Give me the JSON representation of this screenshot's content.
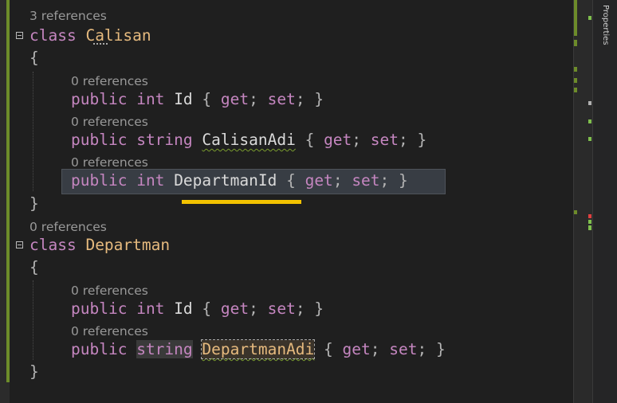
{
  "editor": {
    "blocks": [
      {
        "refs": "3 references",
        "keyword": "class",
        "name": "Calisan",
        "open": "{",
        "close": "}",
        "members": [
          {
            "refs": "0 references",
            "mod": "public",
            "type": "int",
            "name": "Id",
            "acc_open": "{",
            "get": "get",
            "semi1": ";",
            "set": "set",
            "semi2": ";",
            "acc_close": "}"
          },
          {
            "refs": "0 references",
            "mod": "public",
            "type": "string",
            "name": "CalisanAdi",
            "acc_open": "{",
            "get": "get",
            "semi1": ";",
            "set": "set",
            "semi2": ";",
            "acc_close": "}"
          },
          {
            "refs": "0 references",
            "mod": "public",
            "type": "int",
            "name": "DepartmanId",
            "acc_open": "{",
            "get": "get",
            "semi1": ";",
            "set": "set",
            "semi2": ";",
            "acc_close": "}"
          }
        ]
      },
      {
        "refs": "0 references",
        "keyword": "class",
        "name": "Departman",
        "open": "{",
        "close": "}",
        "members": [
          {
            "refs": "0 references",
            "mod": "public",
            "type": "int",
            "name": "Id",
            "acc_open": "{",
            "get": "get",
            "semi1": ";",
            "set": "set",
            "semi2": ";",
            "acc_close": "}"
          },
          {
            "refs": "0 references",
            "mod": "public",
            "type": "string",
            "name": "DepartmanAdi",
            "acc_open": "{",
            "get": "get",
            "semi1": ";",
            "set": "set",
            "semi2": ";",
            "acc_close": "}"
          }
        ]
      }
    ]
  },
  "side_panel": {
    "tab_label": "Properties"
  },
  "colors": {
    "background": "#1f1f1f",
    "keyword": "#c586c0",
    "type_name": "#e6ba7e",
    "identifier": "#dadada",
    "codelens": "#999999",
    "highlight_underline": "#f2c200",
    "change_marker": "#6d8c2a"
  }
}
